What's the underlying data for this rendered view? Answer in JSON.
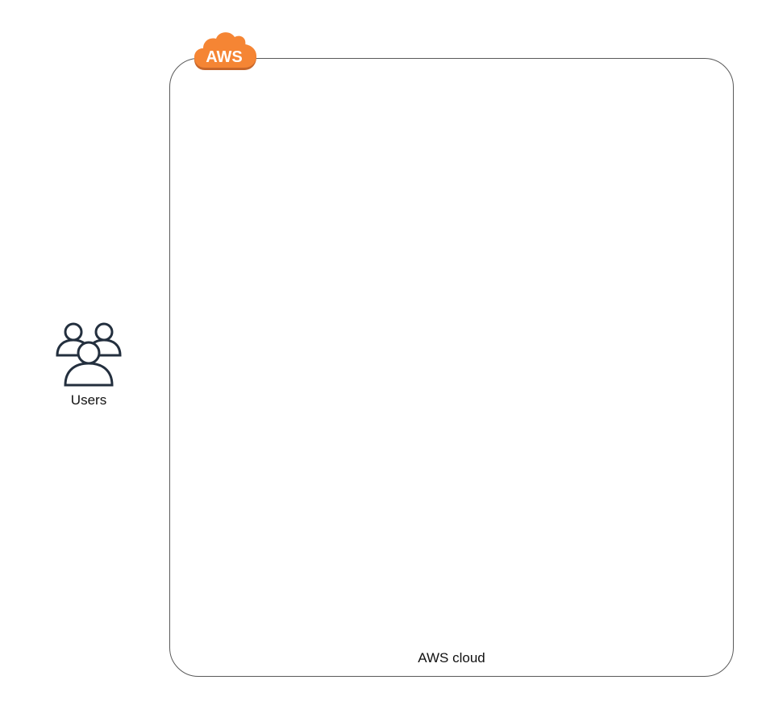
{
  "diagram": {
    "aws_group": {
      "label": "AWS cloud",
      "logo_text": "AWS",
      "border_color": "#5a5a5a",
      "logo_color": "#F58534",
      "logo_shadow_color": "#C7662A"
    },
    "users": {
      "label": "Users",
      "icon": "users-icon",
      "icon_color": "#232F3E"
    }
  }
}
